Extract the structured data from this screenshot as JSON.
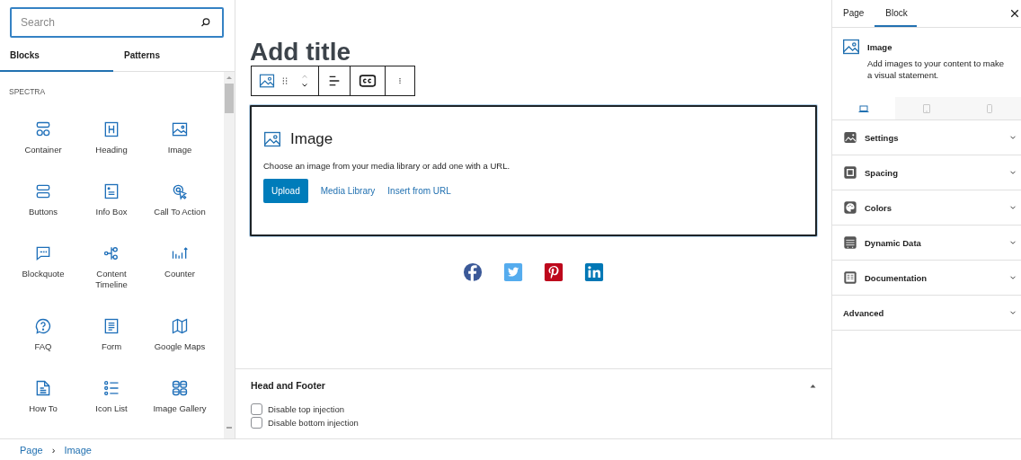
{
  "inserter": {
    "search": {
      "placeholder": "Search"
    },
    "tabs": [
      {
        "label": "Blocks",
        "selected": true
      },
      {
        "label": "Patterns",
        "selected": false
      }
    ],
    "category": "SPECTRA",
    "blocks": [
      {
        "label": "Container"
      },
      {
        "label": "Heading"
      },
      {
        "label": "Image"
      },
      {
        "label": "Buttons"
      },
      {
        "label": "Info Box"
      },
      {
        "label": "Call To Action"
      },
      {
        "label": "Blockquote"
      },
      {
        "label": "Content Timeline"
      },
      {
        "label": "Counter"
      },
      {
        "label": "FAQ"
      },
      {
        "label": "Form"
      },
      {
        "label": "Google Maps"
      },
      {
        "label": "How To"
      },
      {
        "label": "Icon List"
      },
      {
        "label": "Image Gallery"
      }
    ]
  },
  "editor": {
    "title_placeholder": "Add title",
    "image_block": {
      "title": "Image",
      "instructions": "Choose an image from your media library or add one with a URL.",
      "actions": [
        {
          "label": "Upload",
          "kind": "primary"
        },
        {
          "label": "Media Library",
          "kind": "link"
        },
        {
          "label": "Insert from URL",
          "kind": "link"
        }
      ]
    },
    "social_links": [
      {
        "color": "#3b5998"
      },
      {
        "color": "#55acee"
      },
      {
        "color": "#bd081c"
      },
      {
        "color": "#0077b5"
      }
    ],
    "meta_box": {
      "title": "Head and Footer",
      "expanded": true,
      "options": [
        {
          "label": "Disable top injection",
          "checked": false
        },
        {
          "label": "Disable bottom injection",
          "checked": false
        }
      ]
    }
  },
  "inspector": {
    "tabs": [
      {
        "label": "Page",
        "selected": false
      },
      {
        "label": "Block",
        "selected": true
      }
    ],
    "block": {
      "name": "Image",
      "description": "Add images to your content to make a visual statement."
    },
    "devices": [
      {
        "selected": true
      },
      {
        "selected": false
      },
      {
        "selected": false
      }
    ],
    "panels": [
      {
        "title": "Settings",
        "expanded": false
      },
      {
        "title": "Spacing",
        "expanded": false
      },
      {
        "title": "Colors",
        "expanded": false
      },
      {
        "title": "Dynamic Data",
        "expanded": false
      },
      {
        "title": "Documentation",
        "expanded": false
      },
      {
        "title": "Advanced",
        "expanded": false
      }
    ]
  },
  "breadcrumb": {
    "items": [
      "Page",
      "Image"
    ],
    "separator": "›"
  }
}
